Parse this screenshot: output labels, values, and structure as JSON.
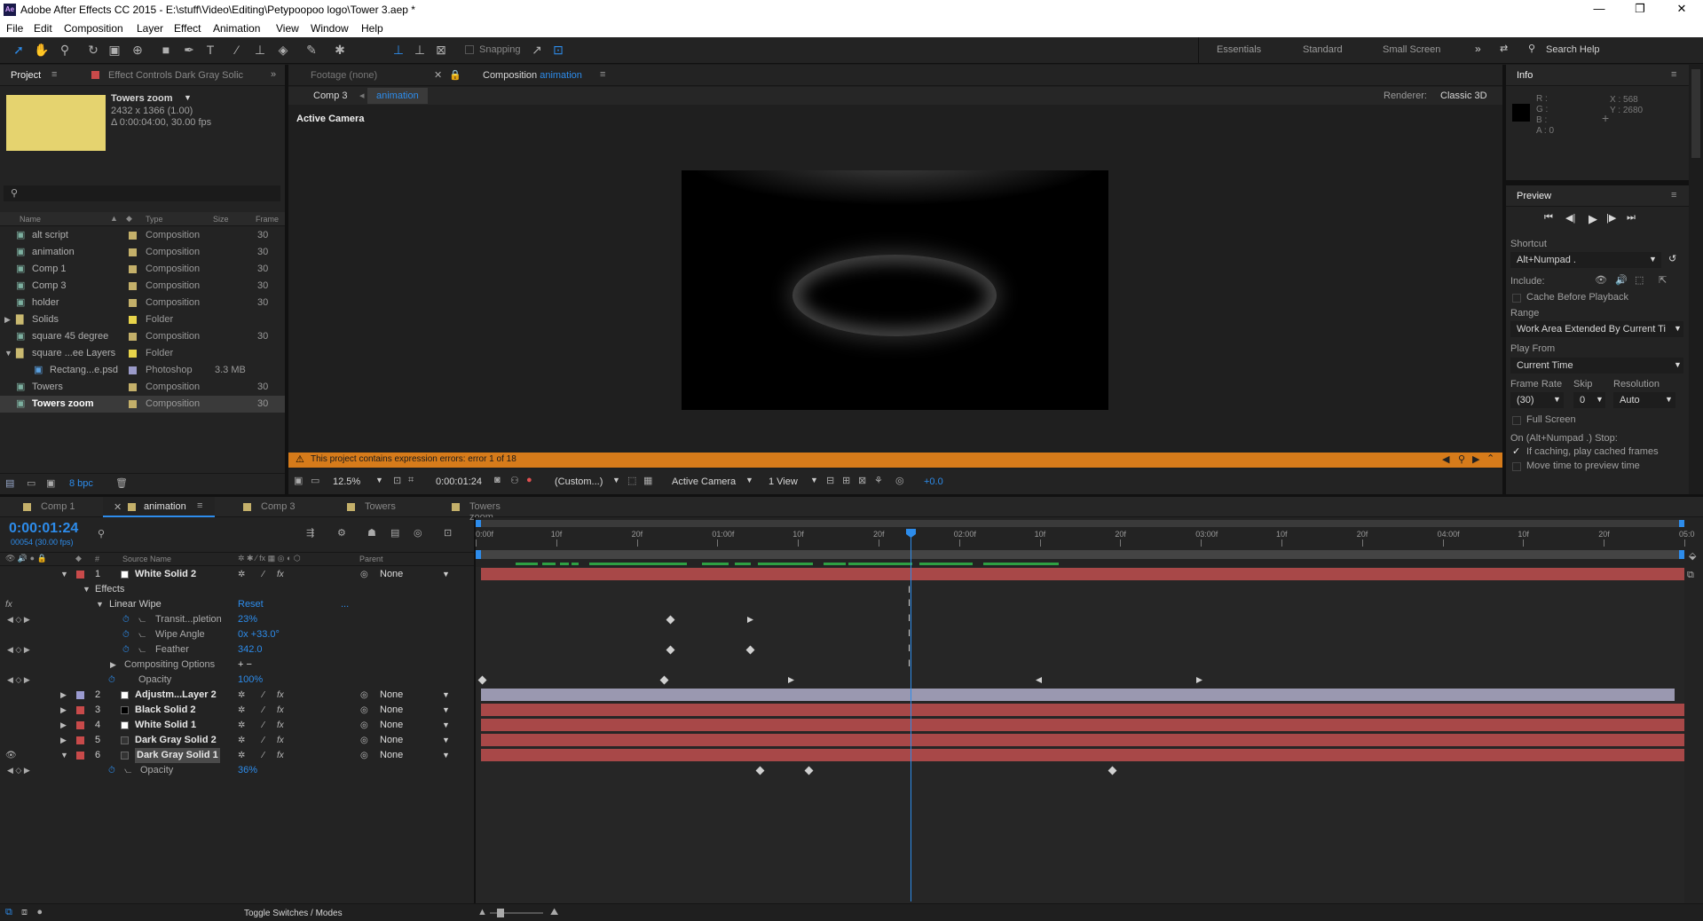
{
  "window": {
    "title": "Adobe After Effects CC 2015 - E:\\stuff\\Video\\Editing\\Petypoopoo logo\\Tower 3.aep *",
    "app_badge": "Ae"
  },
  "menu": [
    "File",
    "Edit",
    "Composition",
    "Layer",
    "Effect",
    "Animation",
    "View",
    "Window",
    "Help"
  ],
  "toolbar": {
    "snapping": "Snapping",
    "workspaces": [
      "Essentials",
      "Standard",
      "Small Screen"
    ],
    "search": "Search Help"
  },
  "project": {
    "tab": "Project",
    "effect_tab": "Effect Controls Dark Gray Solic",
    "thumb_color": "#e5d36f",
    "selected_name": "Towers zoom",
    "selected_dims": "2432 x 1366 (1.00)",
    "selected_dur": "Δ 0:00:04:00, 30.00 fps",
    "columns": [
      "Name",
      "Type",
      "Size",
      "Frame"
    ],
    "items": [
      {
        "name": "alt script",
        "type": "Composition",
        "size": "",
        "frame": "30",
        "color": "#c4b06a",
        "icon": "comp"
      },
      {
        "name": "animation",
        "type": "Composition",
        "size": "",
        "frame": "30",
        "color": "#c4b06a",
        "icon": "comp"
      },
      {
        "name": "Comp 1",
        "type": "Composition",
        "size": "",
        "frame": "30",
        "color": "#c4b06a",
        "icon": "comp"
      },
      {
        "name": "Comp 3",
        "type": "Composition",
        "size": "",
        "frame": "30",
        "color": "#c4b06a",
        "icon": "comp"
      },
      {
        "name": "holder",
        "type": "Composition",
        "size": "",
        "frame": "30",
        "color": "#c4b06a",
        "icon": "comp"
      },
      {
        "name": "Solids",
        "type": "Folder",
        "size": "",
        "frame": "",
        "color": "#e8d44a",
        "icon": "folder"
      },
      {
        "name": "square 45 degree",
        "type": "Composition",
        "size": "",
        "frame": "30",
        "color": "#c4b06a",
        "icon": "comp"
      },
      {
        "name": "square ...ee Layers",
        "type": "Folder",
        "size": "",
        "frame": "",
        "color": "#e8d44a",
        "icon": "folder"
      },
      {
        "name": "Rectang...e.psd",
        "type": "Photoshop",
        "size": "3.3 MB",
        "frame": "",
        "color": "#9a9ac8",
        "icon": "psd"
      },
      {
        "name": "Towers",
        "type": "Composition",
        "size": "",
        "frame": "30",
        "color": "#c4b06a",
        "icon": "comp"
      },
      {
        "name": "Towers zoom",
        "type": "Composition",
        "size": "",
        "frame": "30",
        "color": "#c4b06a",
        "icon": "comp"
      }
    ],
    "bpc": "8 bpc"
  },
  "viewer": {
    "footage_tab": "Footage (none)",
    "comp_tab_prefix": "Composition",
    "comp_tab_name": "animation",
    "crumbs": [
      "Comp 3",
      "animation"
    ],
    "renderer_label": "Renderer:",
    "renderer": "Classic 3D",
    "camera_label": "Active Camera",
    "warning": "This project contains expression errors: error 1 of 18",
    "zoom": "12.5%",
    "timecode": "0:00:01:24",
    "resolution": "(Custom...)",
    "camera": "Active Camera",
    "views": "1 View",
    "exposure": "+0.0"
  },
  "info": {
    "title": "Info",
    "r": "R :",
    "g": "G :",
    "b": "B :",
    "a": "A : 0",
    "x": "X : 568",
    "y": "Y : 2680"
  },
  "preview": {
    "title": "Preview",
    "shortcut_label": "Shortcut",
    "shortcut": "Alt+Numpad .",
    "include_label": "Include:",
    "cache": "Cache Before Playback",
    "range_label": "Range",
    "range": "Work Area Extended By Current Ti",
    "playfrom_label": "Play From",
    "playfrom": "Current Time",
    "framerate_label": "Frame Rate",
    "skip_label": "Skip",
    "resolution_label": "Resolution",
    "framerate": "(30)",
    "skip": "0",
    "resolution": "Auto",
    "fullscreen": "Full Screen",
    "stop_label": "On (Alt+Numpad .) Stop:",
    "if_caching": "If caching, play cached frames",
    "move_time": "Move time to preview time"
  },
  "timeline": {
    "tabs": [
      {
        "name": "Comp 1",
        "color": "#c4b06a",
        "active": false
      },
      {
        "name": "animation",
        "color": "#c4b06a",
        "active": true
      },
      {
        "name": "Comp 3",
        "color": "#c4b06a",
        "active": false
      },
      {
        "name": "Towers",
        "color": "#c4b06a",
        "active": false
      },
      {
        "name": "Towers zoom",
        "color": "#c4b06a",
        "active": false
      }
    ],
    "timecode": "0:00:01:24",
    "frames": "00054 (30.00 fps)",
    "col_num": "#",
    "col_source": "Source Name",
    "col_parent": "Parent",
    "ruler": [
      "0:00f",
      "10f",
      "20f",
      "01:00f",
      "10f",
      "20f",
      "02:00f",
      "10f",
      "20f",
      "03:00f",
      "10f",
      "20f",
      "04:00f",
      "10f",
      "20f",
      "05:0"
    ],
    "layer1": {
      "num": "1",
      "name": "White Solid 2",
      "parent": "None",
      "swatch": "#ffffff"
    },
    "effects_label": "Effects",
    "linear_wipe": "Linear Wipe",
    "reset": "Reset",
    "reset_more": "...",
    "props": [
      {
        "name": "Transit...pletion",
        "value": "23%"
      },
      {
        "name": "Wipe Angle",
        "value": "0x +33.0°"
      },
      {
        "name": "Feather",
        "value": "342.0"
      }
    ],
    "compositing": "Compositing Options",
    "opacity1": {
      "name": "Opacity",
      "value": "100%"
    },
    "layers": [
      {
        "num": "2",
        "name": "Adjustm...Layer 2",
        "parent": "None",
        "swatch": "#ffffff",
        "label": "#9b9bd0"
      },
      {
        "num": "3",
        "name": "Black Solid 2",
        "parent": "None",
        "swatch": "#000000",
        "label": "#c84a4a"
      },
      {
        "num": "4",
        "name": "White Solid 1",
        "parent": "None",
        "swatch": "#ffffff",
        "label": "#c84a4a"
      },
      {
        "num": "5",
        "name": "Dark Gray Solid 2",
        "parent": "None",
        "swatch": "#333333",
        "label": "#c84a4a"
      },
      {
        "num": "6",
        "name": "Dark Gray Solid 1",
        "parent": "None",
        "swatch": "#333333",
        "label": "#c84a4a"
      }
    ],
    "opacity6": {
      "name": "Opacity",
      "value": "36%"
    },
    "toggle": "Toggle Switches / Modes"
  }
}
